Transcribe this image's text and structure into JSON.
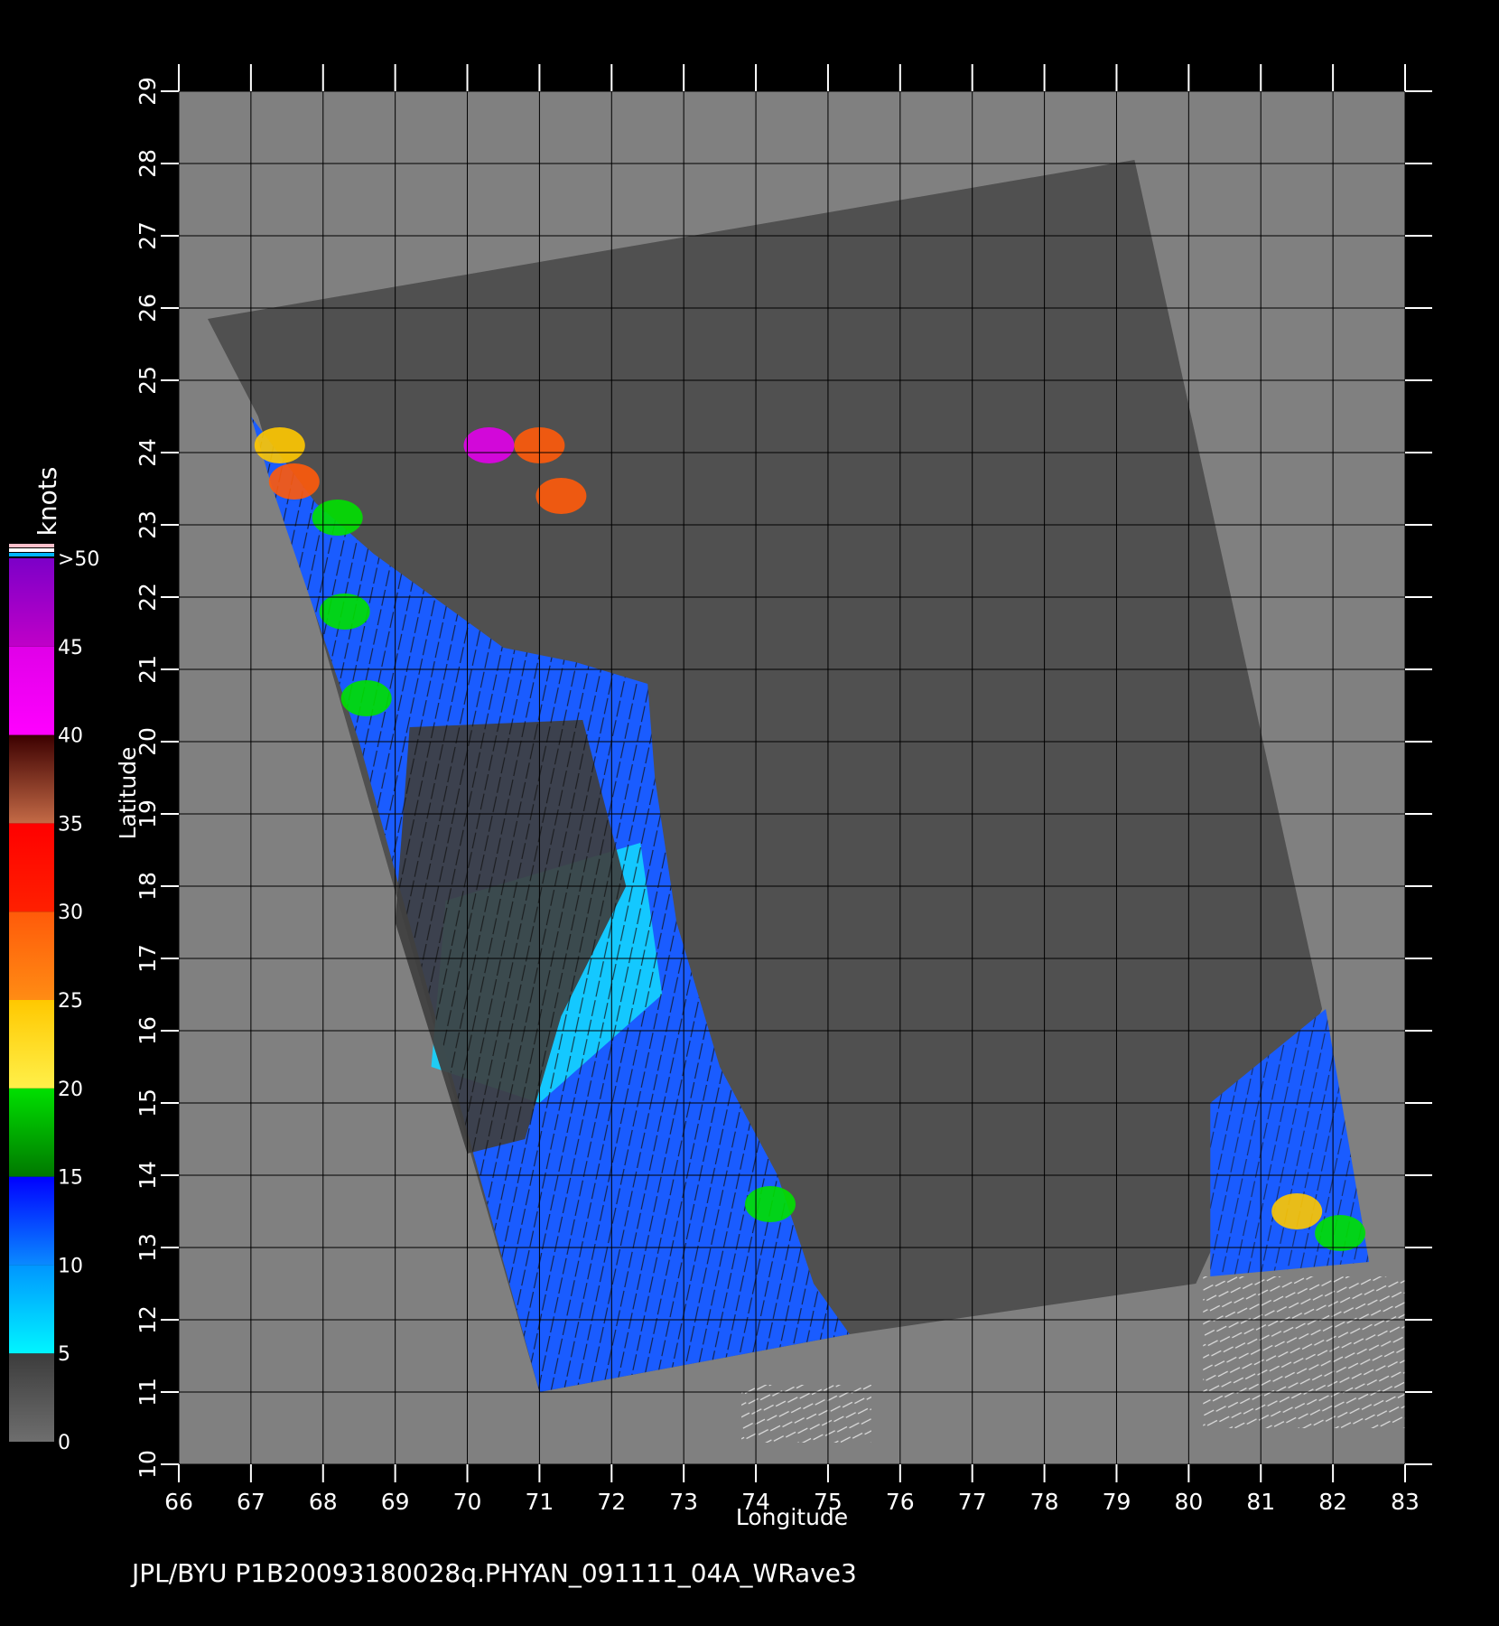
{
  "chart_data": {
    "type": "heatmap",
    "title": "",
    "xlabel": "Longitude",
    "ylabel": "Latitude",
    "xlim": [
      66,
      83
    ],
    "ylim": [
      10,
      29
    ],
    "x_ticks": [
      "66",
      "67",
      "68",
      "69",
      "70",
      "71",
      "72",
      "73",
      "74",
      "75",
      "76",
      "77",
      "78",
      "79",
      "80",
      "81",
      "82",
      "83"
    ],
    "y_ticks": [
      "10",
      "11",
      "12",
      "13",
      "14",
      "15",
      "16",
      "17",
      "18",
      "19",
      "20",
      "21",
      "22",
      "23",
      "24",
      "25",
      "26",
      "27",
      "28",
      "29"
    ],
    "grid": true,
    "colorbar": {
      "unit": "knots",
      "labels": [
        "0",
        "5",
        "10",
        "15",
        "20",
        "25",
        "30",
        "35",
        "40",
        "45",
        ">50"
      ],
      "segments": [
        {
          "from": 0,
          "to": 5,
          "colors": [
            "#6e6e6e",
            "#3c3c3c"
          ]
        },
        {
          "from": 5,
          "to": 10,
          "colors": [
            "#00f5ff",
            "#0096ff"
          ]
        },
        {
          "from": 10,
          "to": 15,
          "colors": [
            "#0a8aff",
            "#0000ff"
          ]
        },
        {
          "from": 15,
          "to": 20,
          "colors": [
            "#007800",
            "#00e000"
          ]
        },
        {
          "from": 20,
          "to": 25,
          "colors": [
            "#fff04a",
            "#ffc800"
          ]
        },
        {
          "from": 25,
          "to": 30,
          "colors": [
            "#ff8c14",
            "#ff5a0a"
          ]
        },
        {
          "from": 30,
          "to": 35,
          "colors": [
            "#ff2000",
            "#ff0000"
          ]
        },
        {
          "from": 35,
          "to": 40,
          "colors": [
            "#c46a46",
            "#3c0000"
          ]
        },
        {
          "from": 40,
          "to": 45,
          "colors": [
            "#ff00ff",
            "#e000e8"
          ]
        },
        {
          "from": 45,
          "to": 50,
          "colors": [
            "#c000c8",
            "#7c00c8"
          ]
        }
      ]
    },
    "swath_polygon_lonlat": [
      [
        66.4,
        25.85
      ],
      [
        79.25,
        28.05
      ],
      [
        81.85,
        16.3
      ],
      [
        80.1,
        12.5
      ],
      [
        75.3,
        11.8
      ],
      [
        71.0,
        11.0
      ],
      [
        67.1,
        24.5
      ]
    ],
    "wind_field_polygon_lonlat": [
      [
        67.0,
        24.5
      ],
      [
        67.9,
        23.3
      ],
      [
        68.7,
        22.6
      ],
      [
        70.5,
        21.3
      ],
      [
        71.5,
        21.1
      ],
      [
        72.5,
        20.8
      ],
      [
        72.6,
        19.5
      ],
      [
        72.9,
        17.5
      ],
      [
        73.5,
        15.5
      ],
      [
        74.3,
        14.0
      ],
      [
        74.8,
        12.5
      ],
      [
        75.3,
        11.8
      ],
      [
        71.0,
        11.0
      ],
      [
        68.5,
        20.0
      ],
      [
        67.3,
        23.5
      ]
    ],
    "bay_of_bengal_polygon_lonlat": [
      [
        80.3,
        15.0
      ],
      [
        81.9,
        16.3
      ],
      [
        82.5,
        12.8
      ],
      [
        80.3,
        12.6
      ]
    ],
    "land_mask_lonlat": [
      [
        66.5,
        25.0
      ],
      [
        80.9,
        27.6
      ],
      [
        81.7,
        16.3
      ],
      [
        80.0,
        12.6
      ],
      [
        75.3,
        11.8
      ],
      [
        74.5,
        13.5
      ],
      [
        73.2,
        16.5
      ],
      [
        72.8,
        19.0
      ],
      [
        72.6,
        20.8
      ],
      [
        71.0,
        21.2
      ],
      [
        69.0,
        22.3
      ],
      [
        68.0,
        23.6
      ],
      [
        67.3,
        24.5
      ]
    ],
    "speed_patches": [
      {
        "lon": 67.6,
        "lat": 23.6,
        "knots": 27
      },
      {
        "lon": 67.4,
        "lat": 24.1,
        "knots": 22
      },
      {
        "lon": 68.2,
        "lat": 23.1,
        "knots": 18
      },
      {
        "lon": 68.3,
        "lat": 21.8,
        "knots": 17
      },
      {
        "lon": 68.6,
        "lat": 20.6,
        "knots": 16
      },
      {
        "lon": 70.3,
        "lat": 24.1,
        "knots": 43
      },
      {
        "lon": 71.0,
        "lat": 24.1,
        "knots": 28
      },
      {
        "lon": 71.3,
        "lat": 23.4,
        "knots": 27
      },
      {
        "lon": 74.2,
        "lat": 13.6,
        "knots": 17
      },
      {
        "lon": 81.5,
        "lat": 13.5,
        "knots": 21
      },
      {
        "lon": 82.1,
        "lat": 13.2,
        "knots": 18
      }
    ],
    "low_wind_region_lonlat": [
      [
        69.2,
        20.2
      ],
      [
        71.6,
        20.3
      ],
      [
        72.2,
        18.0
      ],
      [
        71.3,
        16.2
      ],
      [
        70.8,
        14.5
      ],
      [
        70.0,
        14.3
      ],
      [
        69.0,
        17.5
      ]
    ],
    "light_wind_region_lonlat": [
      [
        69.7,
        17.8
      ],
      [
        72.4,
        18.6
      ],
      [
        72.7,
        16.5
      ],
      [
        71.0,
        15.0
      ],
      [
        69.5,
        15.5
      ]
    ]
  },
  "footer_text": "JPL/BYU  P1B20093180028q.PHYAN_091111_04A_WRave3"
}
